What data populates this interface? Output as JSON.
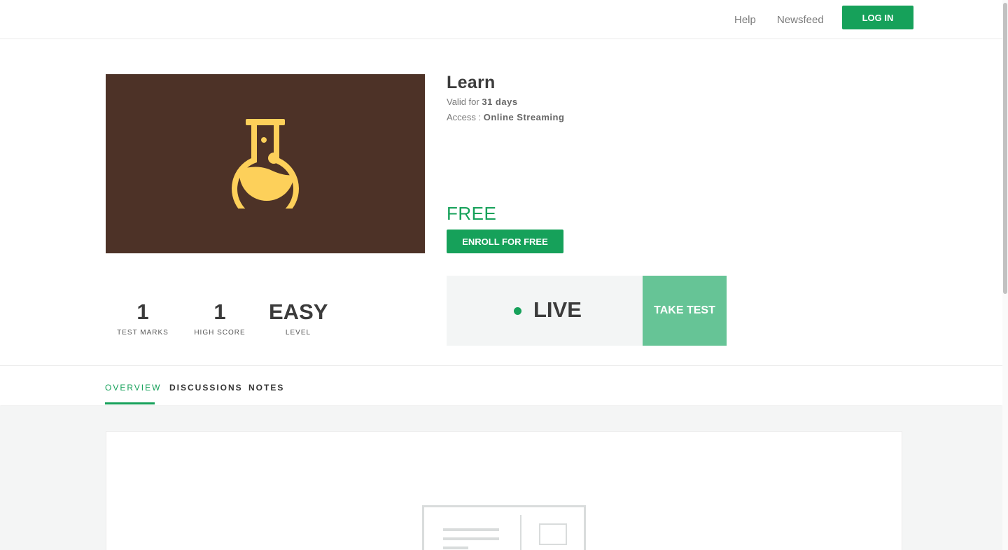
{
  "nav": {
    "help": "Help",
    "newsfeed": "Newsfeed",
    "login": "LOG IN"
  },
  "course": {
    "title": "Learn",
    "valid_prefix": "Valid for",
    "valid_value": "31 days",
    "access_prefix": "Access :",
    "access_value": "Online Streaming",
    "price": "FREE",
    "enroll": "ENROLL FOR FREE",
    "banner_icon": "flask-icon"
  },
  "stats": [
    {
      "value": "1",
      "label": "TEST MARKS"
    },
    {
      "value": "1",
      "label": "HIGH SCORE"
    },
    {
      "value": "EASY",
      "label": "LEVEL"
    }
  ],
  "live": {
    "label": "LIVE",
    "take_test": "TAKE TEST"
  },
  "tabs": [
    {
      "label": "OVERVIEW",
      "active": true
    },
    {
      "label": "DISCUSSIONS",
      "active": false
    },
    {
      "label": "NOTES",
      "active": false
    }
  ],
  "colors": {
    "accent": "#16a15a",
    "banner_bg": "#4d3227",
    "flask": "#fdd05a",
    "take_test_bg": "#66c496"
  }
}
